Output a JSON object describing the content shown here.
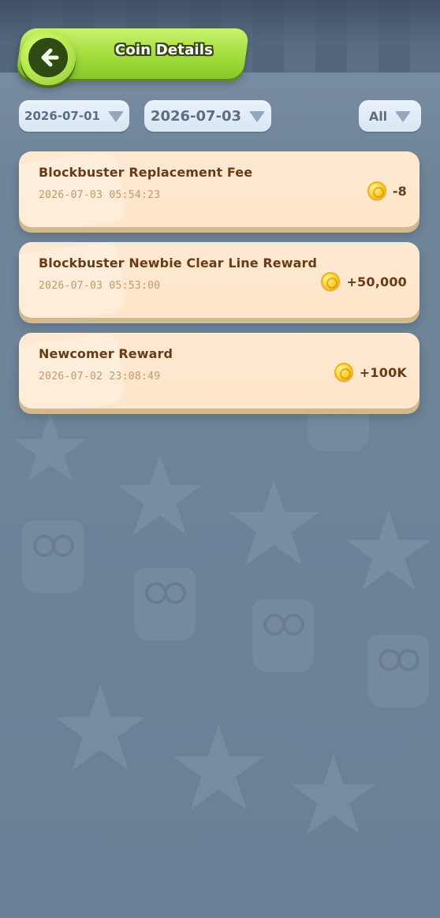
{
  "header": {
    "title": "Coin Details",
    "back_icon": "back-arrow-icon"
  },
  "filters": {
    "start_date": "2026-07-01",
    "end_date": "2026-07-03",
    "type": "All",
    "dropdown_icon": "chevron-down-icon"
  },
  "transactions": [
    {
      "title": "Blockbuster Replacement Fee",
      "time": "2026-07-03 05:54:23",
      "amount": "-8",
      "icon": "coin-icon"
    },
    {
      "title": "Blockbuster Newbie Clear Line Reward",
      "time": "2026-07-03 05:53:00",
      "amount": "+50,000",
      "icon": "coin-icon"
    },
    {
      "title": "Newcomer Reward",
      "time": "2026-07-02 23:08:49",
      "amount": "+100K",
      "icon": "coin-icon"
    }
  ],
  "colors": {
    "background": "#6f8599",
    "header_green": "#9fdc38",
    "card_bg": "#ffe9d2",
    "card_text": "#6a3c16",
    "time_text": "#c59a68"
  }
}
